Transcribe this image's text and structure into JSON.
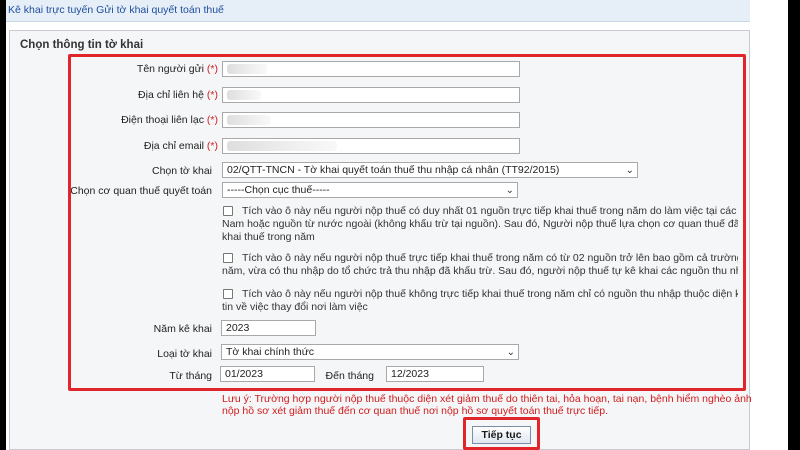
{
  "topbar": {
    "text": "Kê khai trực tuyến Gửi tờ khai quyết toán thuế"
  },
  "panel": {
    "title": "Chọn thông tin tờ khai"
  },
  "form": {
    "required_marker": "(*)",
    "sender_name": {
      "label": "Tên người gửi",
      "value": ""
    },
    "address": {
      "label": "Địa chỉ liên hệ",
      "value": ""
    },
    "phone": {
      "label": "Điện thoại liên lạc",
      "value": ""
    },
    "email": {
      "label": "Địa chỉ email",
      "value": ""
    },
    "declaration": {
      "label": "Chọn tờ khai",
      "value": "02/QTT-TNCN - Tờ khai quyết toán thuế thu nhập cá nhân (TT92/2015)"
    },
    "tax_office": {
      "label": "Chọn cơ quan thuế quyết toán",
      "value": "-----Chọn cục thuế-----"
    },
    "checkbox_1": {
      "line1": "Tích vào ô này nếu người nộp thuế có duy nhất 01 nguồn trực tiếp khai thuế trong năm do làm việc tại các tổ c",
      "line2": "Nam hoặc nguồn từ nước ngoài (không khấu trừ tại nguồn). Sau đó, Người nộp thuế lựa chọn cơ quan thuế đã khai",
      "line3": "khai thuế trong năm"
    },
    "checkbox_2": {
      "line1": "Tích vào ô này nếu người nộp thuế trực tiếp khai thuế trong năm có từ 02 nguồn trở lên bao gồm cả trường hợ",
      "line2": "năm, vừa có thu nhập do tổ chức trả thu nhập đã khấu trừ. Sau đó, người nộp thuế tự kê khai các nguồn thu nhập"
    },
    "checkbox_3": {
      "line1": "Tích vào ô này nếu người nộp thuế không trực tiếp khai thuế trong năm chỉ có nguồn thu nhập thuộc diện khấu",
      "line2": "tin về việc thay đổi nơi làm việc"
    },
    "year": {
      "label": "Năm kê khai",
      "value": "2023"
    },
    "form_type": {
      "label": "Loại tờ khai",
      "value": "Tờ khai chính thức"
    },
    "from_month": {
      "label": "Từ tháng",
      "value": "01/2023"
    },
    "to_month": {
      "label": "Đến tháng",
      "value": "12/2023"
    }
  },
  "note": {
    "line1": "Lưu ý: Trường hợp người nộp thuế thuộc diện xét giảm thuế do thiên tai, hỏa hoạn, tai nạn, bệnh hiểm nghèo ảnh",
    "line2": "nộp hồ sơ xét giảm thuế đến cơ quan thuế nơi nộp hồ sơ quyết toán thuế trực tiếp."
  },
  "continue_button": {
    "label": "Tiếp tục"
  },
  "colors": {
    "highlight": "#e0262a",
    "required": "#d21c1c",
    "topbar_text": "#1f4e9e"
  },
  "icons": {
    "dropdown": "chevron-down-icon",
    "checkbox": "checkbox-icon"
  }
}
